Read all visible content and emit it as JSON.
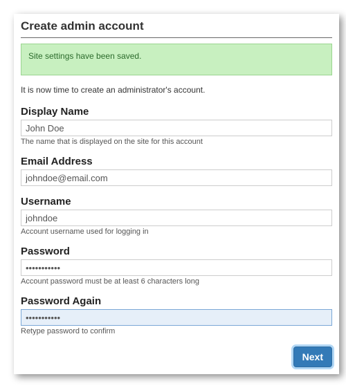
{
  "heading": "Create admin account",
  "alert": "Site settings have been saved.",
  "intro": "It is now time to create an administrator's account.",
  "fields": {
    "display_name": {
      "label": "Display Name",
      "value": "John Doe",
      "hint": "The name that is displayed on the site for this account"
    },
    "email": {
      "label": "Email Address",
      "value": "johndoe@email.com"
    },
    "username": {
      "label": "Username",
      "value": "johndoe",
      "hint": "Account username used for logging in"
    },
    "password": {
      "label": "Password",
      "value": "•••••••••••",
      "hint": "Account password must be at least 6 characters long"
    },
    "password_again": {
      "label": "Password Again",
      "value": "•••••••••••",
      "hint": "Retype password to confirm"
    }
  },
  "buttons": {
    "next": "Next"
  }
}
